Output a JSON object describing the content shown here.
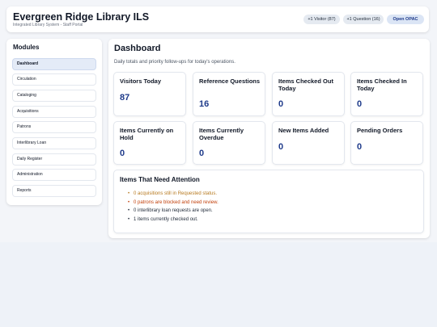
{
  "header": {
    "title": "Evergreen Ridge Library ILS",
    "subtitle": "Integrated Library System - Staff Portal",
    "buttons": {
      "visitor": "+1 Visitor (87)",
      "question": "+1 Question (16)",
      "opac": "Open OPAC"
    }
  },
  "sidebar": {
    "title": "Modules",
    "items": [
      {
        "label": "Dashboard",
        "active": true
      },
      {
        "label": "Circulation"
      },
      {
        "label": "Cataloging"
      },
      {
        "label": "Acquisitions"
      },
      {
        "label": "Patrons"
      },
      {
        "label": "Interlibrary Loan"
      },
      {
        "label": "Daily Register"
      },
      {
        "label": "Administration"
      },
      {
        "label": "Reports"
      }
    ]
  },
  "main": {
    "title": "Dashboard",
    "subtitle": "Daily totals and priority follow-ups for today's operations.",
    "cards": [
      {
        "label": "Visitors Today",
        "value": "87"
      },
      {
        "label": "Reference Questions",
        "value": "16"
      },
      {
        "label": "Items Checked Out Today",
        "value": "0"
      },
      {
        "label": "Items Checked In Today",
        "value": "0"
      },
      {
        "label": "Items Currently on Hold",
        "value": "0"
      },
      {
        "label": "Items Currently Overdue",
        "value": "0"
      },
      {
        "label": "New Items Added",
        "value": "0"
      },
      {
        "label": "Pending Orders",
        "value": "0"
      }
    ],
    "attention": {
      "title": "Items That Need Attention",
      "items": [
        {
          "text": "0 acquisitions still in Requested status.",
          "level": "warn"
        },
        {
          "text": "0 patrons are blocked and need review.",
          "level": "danger"
        },
        {
          "text": "0 interlibrary loan requests are open.",
          "level": "normal"
        },
        {
          "text": "1 items currently checked out.",
          "level": "normal"
        }
      ]
    }
  },
  "colors": {
    "accent": "#1e3a8a",
    "warn": "#b7791f",
    "danger": "#c2410c"
  }
}
